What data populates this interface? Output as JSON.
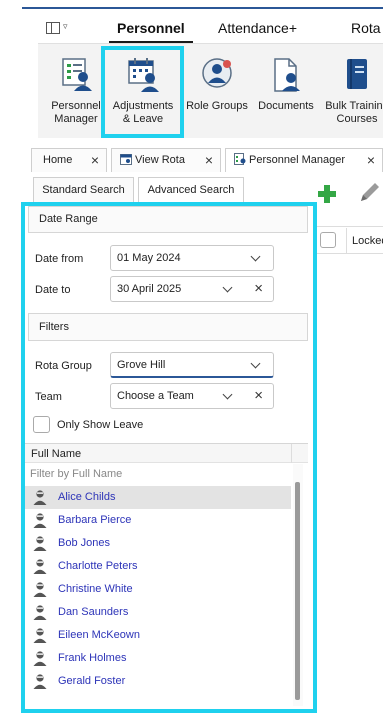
{
  "top_menu": {
    "tabs": [
      {
        "label": "Personnel",
        "active": true
      },
      {
        "label": "Attendance+"
      },
      {
        "label": "Rota"
      }
    ]
  },
  "ribbon": {
    "buttons": [
      {
        "label_line1": "Personnel",
        "label_line2": "Manager",
        "icon": "personnel-manager-icon"
      },
      {
        "label_line1": "Adjustments",
        "label_line2": "& Leave",
        "icon": "calendar-person-icon",
        "highlighted": true
      },
      {
        "label_line1": "Role Groups",
        "label_line2": "",
        "icon": "role-groups-icon"
      },
      {
        "label_line1": "Documents",
        "label_line2": "",
        "icon": "document-person-icon"
      },
      {
        "label_line1": "Bulk Training",
        "label_line2": "Courses",
        "icon": "training-book-icon"
      }
    ]
  },
  "doc_tabs": [
    {
      "label": "Home",
      "close": "×"
    },
    {
      "label": "View Rota",
      "close": "×"
    },
    {
      "label": "Personnel Manager",
      "close": "×",
      "active": true
    }
  ],
  "search_tabs": [
    {
      "label": "Standard Search",
      "active": true
    },
    {
      "label": "Advanced Search"
    }
  ],
  "grid": {
    "column": "Locked"
  },
  "date_range": {
    "title": "Date Range",
    "from_label": "Date from",
    "from_value": "01 May 2024",
    "to_label": "Date to",
    "to_value": "30 April 2025"
  },
  "filters": {
    "title": "Filters",
    "rota_group_label": "Rota Group",
    "rota_group_value": "Grove Hill",
    "team_label": "Team",
    "team_value": "Choose a Team",
    "only_show_leave_label": "Only Show Leave",
    "only_show_leave_checked": false
  },
  "list": {
    "header": "Full Name",
    "filter_placeholder": "Filter by Full Name",
    "people": [
      {
        "name": "Alice Childs",
        "selected": true
      },
      {
        "name": "Barbara Pierce"
      },
      {
        "name": "Bob Jones"
      },
      {
        "name": "Charlotte Peters"
      },
      {
        "name": "Christine White"
      },
      {
        "name": "Dan Saunders"
      },
      {
        "name": "Eileen McKeown"
      },
      {
        "name": "Frank Holmes"
      },
      {
        "name": "Gerald Foster"
      }
    ]
  },
  "colors": {
    "highlight": "#1fd1ee",
    "link": "#2d34b8",
    "accent": "#2b5797",
    "add_green": "#34a745"
  }
}
